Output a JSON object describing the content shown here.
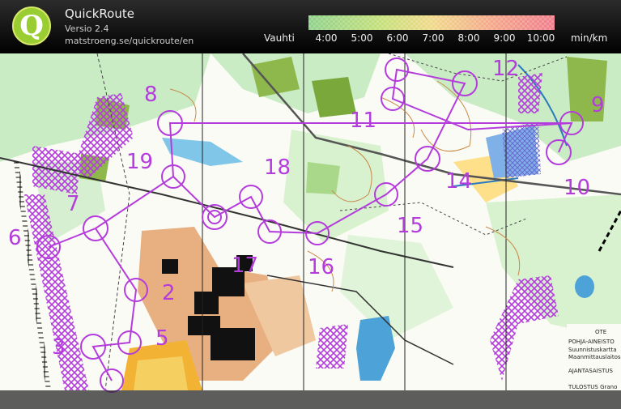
{
  "app": {
    "name": "QuickRoute",
    "version": "Versio 2.4",
    "url": "matstroeng.se/quickroute/en"
  },
  "pace_scale": {
    "label": "Vauhti",
    "unit": "min/km",
    "ticks": [
      "4:00",
      "5:00",
      "6:00",
      "7:00",
      "8:00",
      "9:00",
      "10:00"
    ],
    "colors": [
      "#8fd18a",
      "#c6e07a",
      "#f0d98a",
      "#f4a78a",
      "#f07e8c"
    ]
  },
  "map": {
    "course_color": "#b43cdc",
    "control_numbers": [
      "2",
      "3",
      "5",
      "6",
      "7",
      "8",
      "9",
      "10",
      "11",
      "12",
      "14",
      "15",
      "16",
      "17",
      "18",
      "19"
    ],
    "legend_text": [
      "OTE",
      "POHJA-AINEISTO",
      "Suunnistuskartta",
      "Maanmittauslaitos",
      "AJANTASAISTUS",
      "TULOSTUS Grano"
    ]
  }
}
